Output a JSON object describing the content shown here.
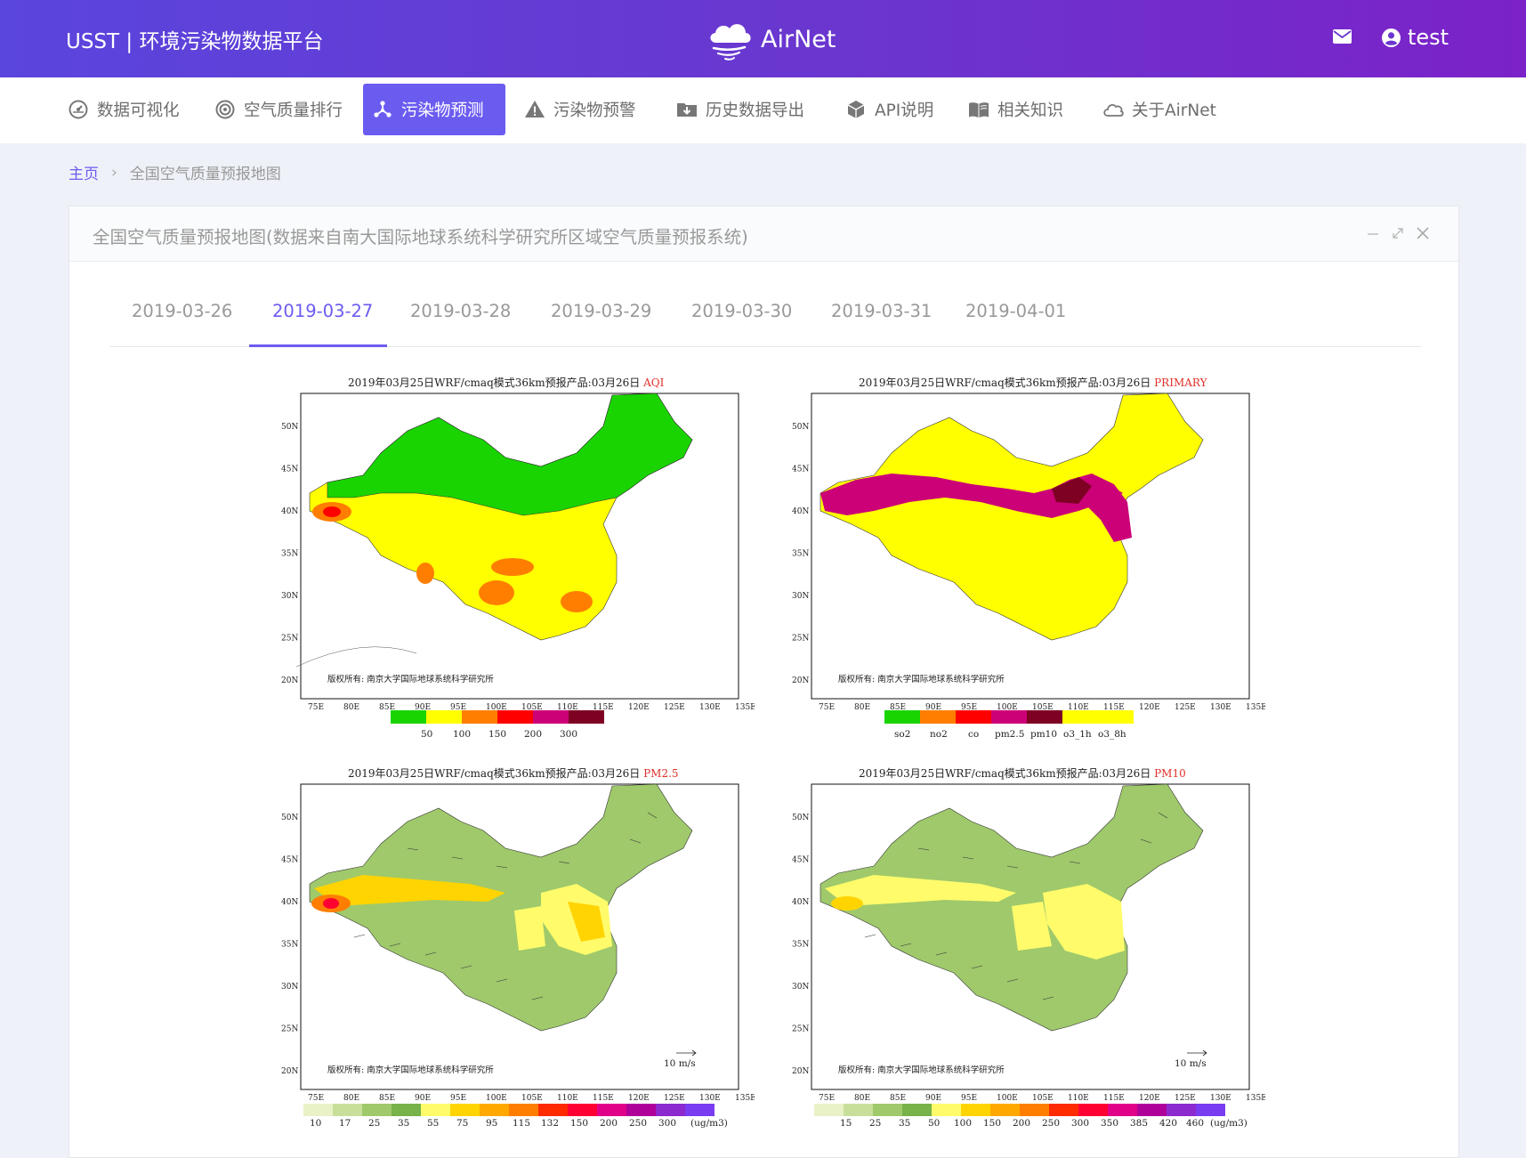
{
  "header": {
    "brand": "USST | 环境污染物数据平台",
    "logo_text": "AirNet",
    "user": "test"
  },
  "nav": [
    {
      "label": "数据可视化",
      "icon": "dashboard-icon"
    },
    {
      "label": "空气质量排行",
      "icon": "target-icon"
    },
    {
      "label": "污染物预测",
      "icon": "network-icon",
      "active": true
    },
    {
      "label": "污染物预警",
      "icon": "warning-icon"
    },
    {
      "label": "历史数据导出",
      "icon": "folder-download-icon"
    },
    {
      "label": "API说明",
      "icon": "cube-icon"
    },
    {
      "label": "相关知识",
      "icon": "book-icon"
    },
    {
      "label": "关于AirNet",
      "icon": "cloud-icon"
    }
  ],
  "breadcrumb": {
    "home": "主页",
    "current": "全国空气质量预报地图"
  },
  "panel": {
    "title": "全国空气质量预报地图(数据来自南大国际地球系统科学研究所区域空气质量预报系统)"
  },
  "tabs": [
    "2019-03-26",
    "2019-03-27",
    "2019-03-28",
    "2019-03-29",
    "2019-03-30",
    "2019-03-31",
    "2019-04-01"
  ],
  "active_tab": "2019-03-27",
  "maps": {
    "title_prefix": "2019年03月25日WRF/cmaq模式36km预报产品:03月26日",
    "copyright": "版权所有: 南京大学国际地球系统科学研究所",
    "lat_ticks": [
      "50N",
      "45N",
      "40N",
      "35N",
      "30N",
      "25N",
      "20N"
    ],
    "lon_ticks": [
      "75E",
      "80E",
      "85E",
      "90E",
      "95E",
      "100E",
      "105E",
      "110E",
      "115E",
      "120E",
      "125E",
      "130E",
      "135E"
    ],
    "wind_ref": "10 m/s",
    "aqi": {
      "variable": "AQI",
      "legend_labels": [
        "50",
        "100",
        "150",
        "200",
        "300"
      ],
      "legend_colors": [
        "#19d400",
        "#ffff00",
        "#ff7e00",
        "#ff0000",
        "#cc0077",
        "#7e0023"
      ]
    },
    "primary": {
      "variable": "PRIMARY",
      "legend_labels": [
        "so2",
        "no2",
        "co",
        "pm2.5",
        "pm10",
        "o3_1h",
        "o3_8h"
      ],
      "legend_colors": [
        "#19d400",
        "#ff7e00",
        "#ff0000",
        "#cc0077",
        "#7e0023",
        "#ffff00",
        "#ffff00"
      ]
    },
    "pm25": {
      "variable": "PM2.5",
      "legend_labels": [
        "10",
        "17",
        "25",
        "35",
        "55",
        "75",
        "95",
        "115",
        "132",
        "150",
        "200",
        "250",
        "300",
        "(ug/m3)"
      ],
      "legend_colors": [
        "#e9f2c7",
        "#c8df9a",
        "#9fc96b",
        "#77b24a",
        "#fffb6b",
        "#ffd400",
        "#ffa900",
        "#ff7e00",
        "#ff2a00",
        "#ff0033",
        "#e0008a",
        "#b0009a",
        "#8c2ad0",
        "#7a3cf0"
      ]
    },
    "pm10": {
      "variable": "PM10",
      "legend_labels": [
        "15",
        "25",
        "35",
        "50",
        "100",
        "150",
        "200",
        "250",
        "300",
        "350",
        "385",
        "420",
        "460",
        "(ug/m3)"
      ],
      "legend_colors": [
        "#e9f2c7",
        "#c8df9a",
        "#9fc96b",
        "#77b24a",
        "#fffb6b",
        "#ffd400",
        "#ffa900",
        "#ff7e00",
        "#ff2a00",
        "#ff0033",
        "#e0008a",
        "#b0009a",
        "#8c2ad0",
        "#7a3cf0"
      ]
    }
  }
}
